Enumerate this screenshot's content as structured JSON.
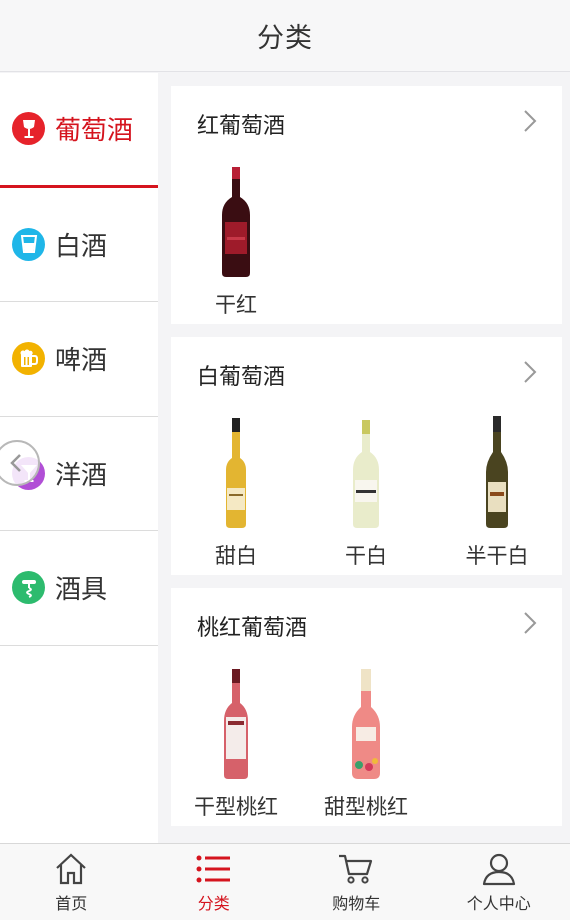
{
  "header": {
    "title": "分类"
  },
  "sidebar": {
    "items": [
      {
        "label": "葡萄酒",
        "icon": "wine-glass-icon",
        "color": "#e6232b",
        "active": true
      },
      {
        "label": "白酒",
        "icon": "cup-icon",
        "color": "#1fb6e8",
        "active": false
      },
      {
        "label": "啤酒",
        "icon": "beer-mug-icon",
        "color": "#f2b200",
        "active": false
      },
      {
        "label": "洋酒",
        "icon": "cocktail-glass-icon",
        "color": "#b14fd6",
        "active": false
      },
      {
        "label": "酒具",
        "icon": "corkscrew-icon",
        "color": "#2dbb6e",
        "active": false
      }
    ]
  },
  "categories": [
    {
      "title": "红葡萄酒",
      "products": [
        {
          "name": "干红"
        }
      ]
    },
    {
      "title": "白葡萄酒",
      "products": [
        {
          "name": "甜白"
        },
        {
          "name": "干白"
        },
        {
          "name": "半干白"
        }
      ]
    },
    {
      "title": "桃红葡萄酒",
      "products": [
        {
          "name": "干型桃红"
        },
        {
          "name": "甜型桃红"
        }
      ]
    }
  ],
  "bottom_nav": {
    "items": [
      {
        "label": "首页",
        "icon": "home-icon",
        "active": false
      },
      {
        "label": "分类",
        "icon": "list-icon",
        "active": true
      },
      {
        "label": "购物车",
        "icon": "cart-icon",
        "active": false
      },
      {
        "label": "个人中心",
        "icon": "user-icon",
        "active": false
      }
    ]
  },
  "colors": {
    "accent": "#d5141e",
    "background": "#f4f4f6"
  }
}
